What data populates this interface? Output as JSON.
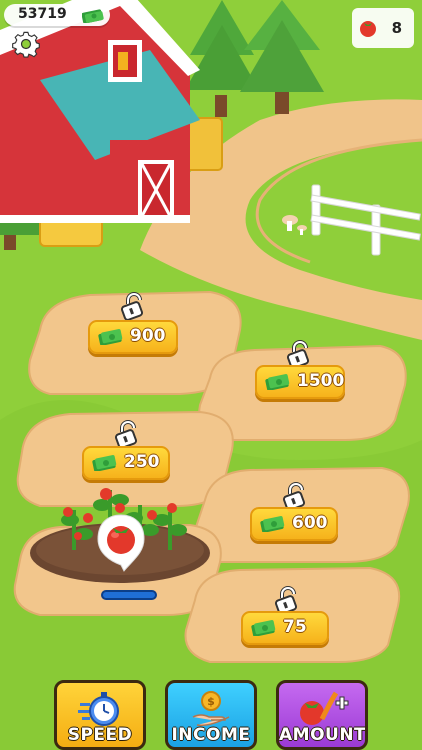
{
  "hud": {
    "money": "53719",
    "tomatoes": "8"
  },
  "plots": [
    {
      "price": "900"
    },
    {
      "price": "1500"
    },
    {
      "price": "250"
    },
    {
      "price": "600"
    },
    {
      "price": "75"
    }
  ],
  "active_plot": {
    "crop": "tomato",
    "progress": 0
  },
  "buttons": {
    "speed": "SPEED",
    "income": "INCOME",
    "amount": "AMOUNT"
  },
  "colors": {
    "grass": "#8fcf3a",
    "dirt": "#f2c68c",
    "price_yellow": "#ffd93c",
    "speed_btn": "#f7c41f",
    "income_btn": "#27b9ef",
    "amount_btn": "#b14fe0"
  }
}
